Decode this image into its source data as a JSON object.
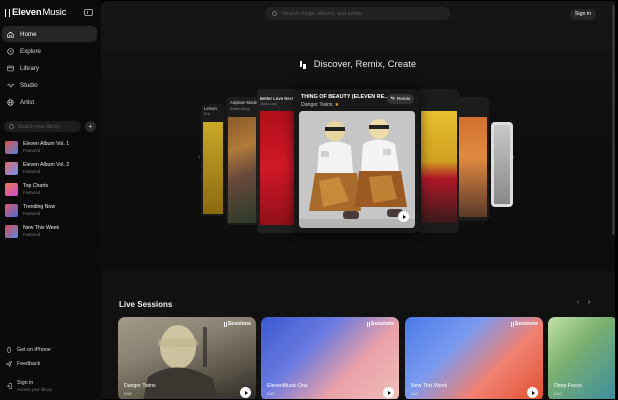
{
  "app": {
    "logo_bold": "Eleven",
    "logo_thin": "Music"
  },
  "sidebar": {
    "nav": [
      {
        "label": "Home",
        "icon": "home-icon"
      },
      {
        "label": "Explore",
        "icon": "compass-icon"
      },
      {
        "label": "Library",
        "icon": "library-icon"
      },
      {
        "label": "Studio",
        "icon": "studio-icon"
      },
      {
        "label": "Artist",
        "icon": "globe-icon"
      }
    ],
    "search_placeholder": "Search your library",
    "playlists": [
      {
        "title": "Eleven Album Vol. 1",
        "sub": "Featured",
        "c1": "#d9534f",
        "c2": "#5b7fd9"
      },
      {
        "title": "Eleven Album Vol. 2",
        "sub": "Featured",
        "c1": "#e46a6a",
        "c2": "#6d8ff0"
      },
      {
        "title": "Top Charts",
        "sub": "Featured",
        "c1": "#f07a4a",
        "c2": "#c84ad8"
      },
      {
        "title": "Trending Now",
        "sub": "Featured",
        "c1": "#e05a6a",
        "c2": "#4a6ad8"
      },
      {
        "title": "New This Week",
        "sub": "Featured",
        "c1": "#d84a5a",
        "c2": "#5a8ae0"
      }
    ],
    "get_iphone": "Get on iPhone",
    "feedback": "Feedback",
    "signin": "Sign in",
    "signin_sub": "Access your library"
  },
  "header": {
    "search_placeholder": "Search songs, albums, and artists",
    "signin": "Sign in"
  },
  "hero": {
    "title": "Discover, Remix, Create",
    "featured": {
      "title": "THING OF BEAUTY (ELEVEN RE...",
      "artist": "Danger Twins",
      "remix_label": "Remix"
    },
    "side_cards": {
      "far_left_title": "Lemon",
      "far_left_sub": "Eric",
      "left2_title": "Airplane Mode",
      "left2_sub": "Rosen Berg",
      "left1_title": "Better Love Next T",
      "left1_sub": "Judio Lost"
    }
  },
  "live_sessions": {
    "title": "Live Sessions",
    "badge": "Sessions",
    "items": [
      {
        "name": "Danger Twins",
        "sub": "Live"
      },
      {
        "name": "ElevenMusic One",
        "sub": "Live"
      },
      {
        "name": "New This Week",
        "sub": "Live"
      },
      {
        "name": "Deep Focus",
        "sub": "Live"
      }
    ]
  },
  "colors": {
    "bg": "#000000",
    "panel": "#111111",
    "sidebar": "#0b0b0b",
    "active": "#262626",
    "star": "#f0c040"
  }
}
